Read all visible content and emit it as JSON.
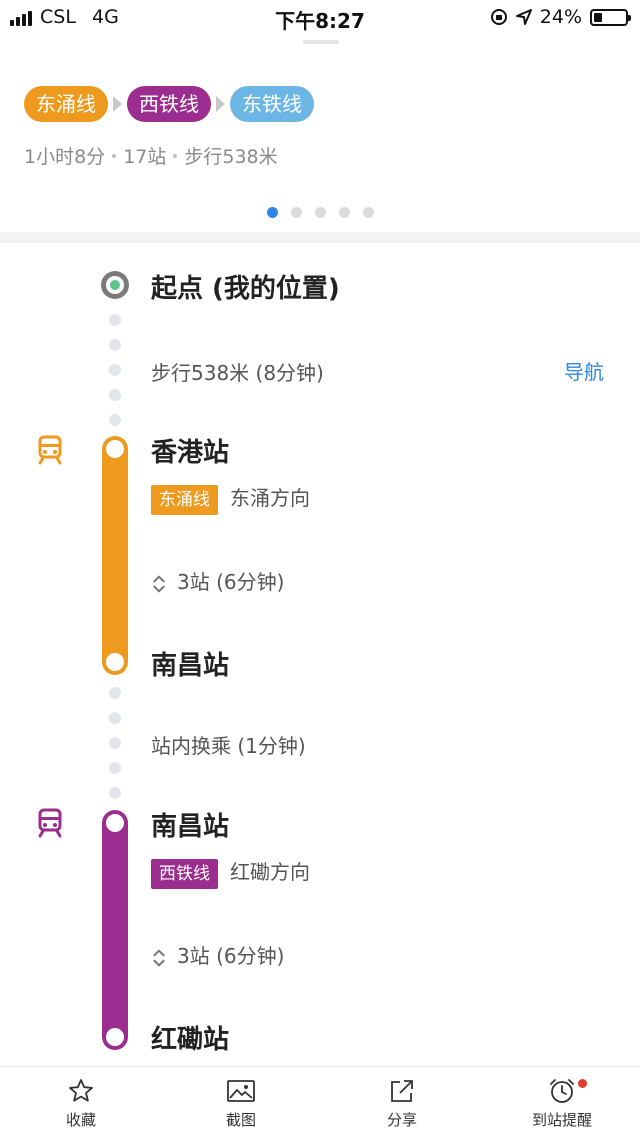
{
  "status_bar": {
    "carrier": "CSL",
    "network": "4G",
    "time": "下午8:27",
    "battery": "24%"
  },
  "route": {
    "lines": [
      {
        "label": "东涌线",
        "color": "#EE9A1E"
      },
      {
        "label": "西铁线",
        "color": "#9A2D8E"
      },
      {
        "label": "东铁线",
        "color": "#6CB6E6"
      }
    ],
    "summary": {
      "duration": "1小时8分",
      "stations": "17站",
      "walk": "步行538米"
    },
    "pages": {
      "count": 5,
      "active": 1
    }
  },
  "steps": {
    "start": {
      "title": "起点 (我的位置)",
      "walk": "步行538米 (8分钟)",
      "nav_label": "导航"
    },
    "leg1": {
      "color": "#EE9A1E",
      "board": "香港站",
      "line": "东涌线",
      "direction": "东涌方向",
      "stops": "3站 (6分钟)",
      "alight": "南昌站"
    },
    "transfer": {
      "text": "站内换乘 (1分钟)"
    },
    "leg2": {
      "color": "#9A2D8E",
      "board": "南昌站",
      "line": "西铁线",
      "direction": "红磡方向",
      "stops": "3站 (6分钟)",
      "alight": "红磡站"
    }
  },
  "bottom_bar": {
    "favorite": "收藏",
    "screenshot": "截图",
    "share": "分享",
    "arrival_alert": "到站提醒"
  }
}
